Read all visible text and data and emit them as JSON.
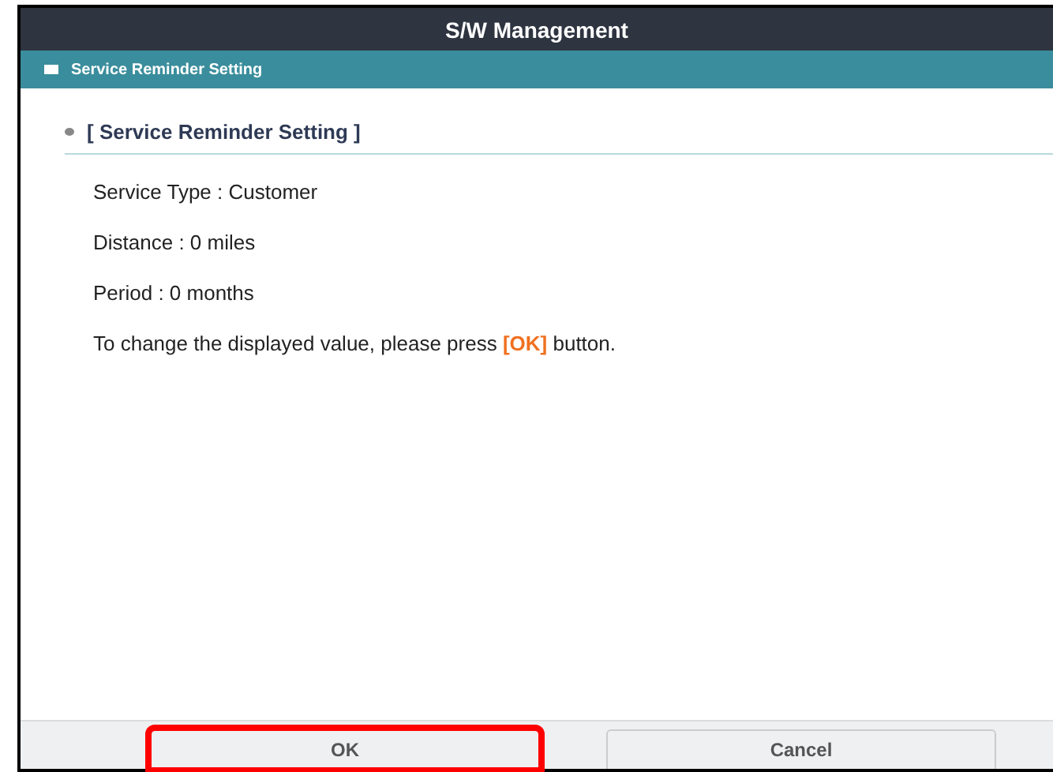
{
  "window": {
    "title": "S/W Management"
  },
  "section_bar": {
    "title": "Service Reminder Setting"
  },
  "panel": {
    "heading": "[ Service Reminder Setting ]",
    "lines": [
      "Service Type : Customer",
      "Distance : 0 miles",
      "Period : 0 months",
      "To change the displayed value, please press **[OK]** button."
    ]
  },
  "buttons": [
    {
      "label": "OK",
      "highlighted": true
    },
    {
      "label": "Cancel",
      "highlighted": false
    }
  ]
}
